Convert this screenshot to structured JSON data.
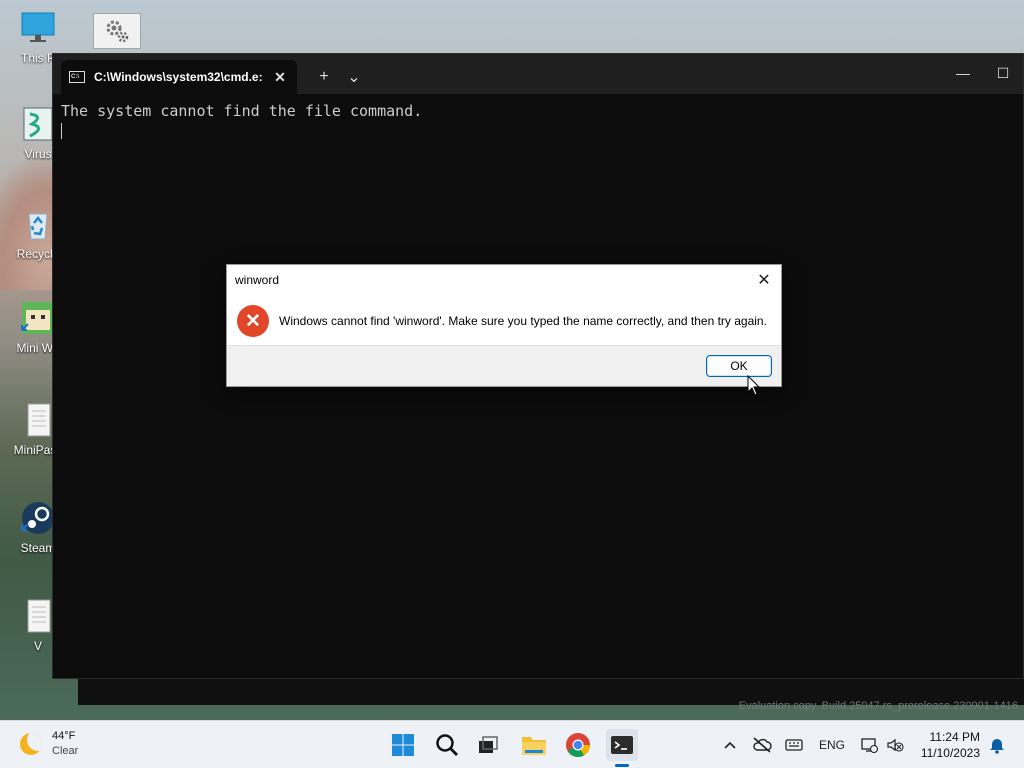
{
  "desktop": {
    "icons": [
      {
        "label": "This P"
      },
      {
        "label": "Virus"
      },
      {
        "label": "Recycle"
      },
      {
        "label": "Mini Wo"
      },
      {
        "label": "MiniPass"
      },
      {
        "label": "Steam"
      },
      {
        "label": "V"
      }
    ],
    "watermark": "Evaluation copy. Build 25947.rs_prerelease.230901-1416"
  },
  "terminal": {
    "tab_title": "C:\\Windows\\system32\\cmd.e:",
    "output_line": "The system cannot find the file command.",
    "minimize_glyph": "—",
    "maximize_glyph": "☐",
    "add_tab_glyph": "+",
    "dropdown_glyph": "⌄",
    "close_tab_glyph": "✕"
  },
  "dialog": {
    "title": "winword",
    "message": "Windows cannot find 'winword'. Make sure you typed the name correctly, and then try again.",
    "ok_label": "OK",
    "close_glyph": "✕",
    "error_glyph": "✕",
    "error_color": "#e04627"
  },
  "taskbar": {
    "weather": {
      "temp": "44°F",
      "condition": "Clear"
    },
    "language": "ENG",
    "time": "11:24 PM",
    "date": "11/10/2023",
    "accent": "#0067c0"
  }
}
